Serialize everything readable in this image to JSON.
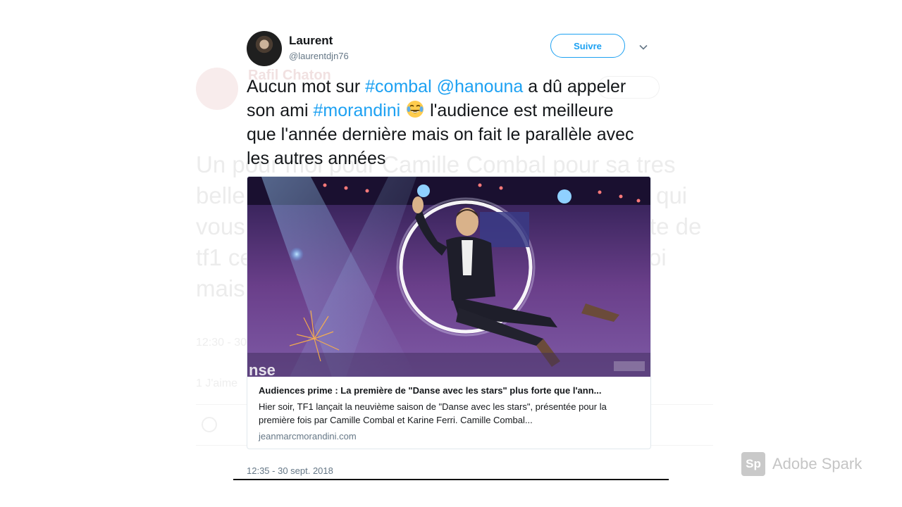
{
  "background_tweet": {
    "name": "Rafil Chaton",
    "text": "Un pour moi pour Camille Combal pour sa tres belle presentation il vous a dit par la bouche qui vous nourrit nouna ? Faites attention de chute de tf1 ce sera tot ou tard ca sert a rien d etre moi mais a ce malade la",
    "meta": "12:30 - 30 sept. 2018",
    "likes": "1 J'aime"
  },
  "tweet": {
    "display_name": "Laurent",
    "handle": "@laurentdjn76",
    "follow_label": "Suivre",
    "text_parts": {
      "p1": "Aucun mot sur ",
      "tag_combal": "#combal",
      "p2": " ",
      "mention_hanouna": "@hanouna",
      "p3": " a dû appeler son ami ",
      "tag_morandini": "#morandini",
      "p4": " ",
      "p5": " l'audience est meilleure que l'année dernière mais on fait le parallèle avec les autres années"
    },
    "timestamp": "12:35 - 30 sept. 2018"
  },
  "card": {
    "title": "Audiences prime : La première de \"Danse avec les stars\" plus forte que l'ann...",
    "description": "Hier soir, TF1 lançait la neuvième saison de \"Danse avec les stars\", présentée pour la première fois par Camille Combal et Karine Ferri. Camille Combal...",
    "domain": "jeanmarcmorandini.com",
    "image_overlay_text": "nse"
  },
  "watermark": {
    "logo_text": "Sp",
    "label": "Adobe Spark"
  },
  "icons": {
    "emoji": "face-with-tears-of-joy-icon",
    "chevron": "chevron-down-icon"
  },
  "colors": {
    "link": "#1da1f2",
    "text": "#14171a",
    "muted": "#657786"
  }
}
